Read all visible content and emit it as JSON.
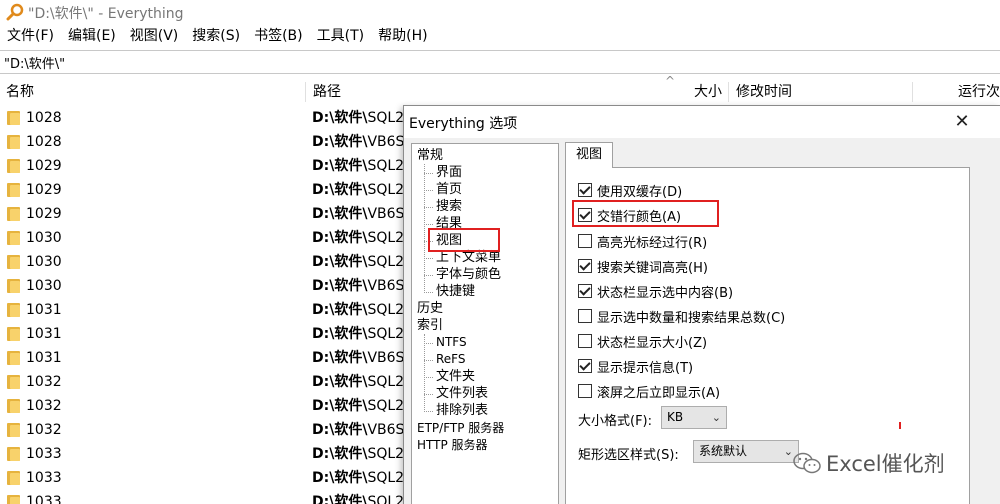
{
  "window": {
    "title": "\"D:\\软件\\\" - Everything",
    "menus": [
      "文件(F)",
      "编辑(E)",
      "视图(V)",
      "搜索(S)",
      "书签(B)",
      "工具(T)",
      "帮助(H)"
    ],
    "search_value": "\"D:\\软件\\\""
  },
  "columns": {
    "name": "名称",
    "path": "路径",
    "size": "大小",
    "modified": "修改时间",
    "run_count": "运行次"
  },
  "rows": [
    {
      "name": "1028",
      "path_bold": "D:\\软件\\",
      "path_rest": "SQL2"
    },
    {
      "name": "1028",
      "path_bold": "D:\\软件\\",
      "path_rest": "VB6S"
    },
    {
      "name": "1029",
      "path_bold": "D:\\软件\\",
      "path_rest": "SQL2"
    },
    {
      "name": "1029",
      "path_bold": "D:\\软件\\",
      "path_rest": "SQL2"
    },
    {
      "name": "1029",
      "path_bold": "D:\\软件\\",
      "path_rest": "VB6S"
    },
    {
      "name": "1030",
      "path_bold": "D:\\软件\\",
      "path_rest": "SQL2"
    },
    {
      "name": "1030",
      "path_bold": "D:\\软件\\",
      "path_rest": "SQL2"
    },
    {
      "name": "1030",
      "path_bold": "D:\\软件\\",
      "path_rest": "VB6S"
    },
    {
      "name": "1031",
      "path_bold": "D:\\软件\\",
      "path_rest": "SQL2"
    },
    {
      "name": "1031",
      "path_bold": "D:\\软件\\",
      "path_rest": "SQL2"
    },
    {
      "name": "1031",
      "path_bold": "D:\\软件\\",
      "path_rest": "VB6S"
    },
    {
      "name": "1032",
      "path_bold": "D:\\软件\\",
      "path_rest": "SQL2"
    },
    {
      "name": "1032",
      "path_bold": "D:\\软件\\",
      "path_rest": "SQL2"
    },
    {
      "name": "1032",
      "path_bold": "D:\\软件\\",
      "path_rest": "VB6S"
    },
    {
      "name": "1033",
      "path_bold": "D:\\软件\\",
      "path_rest": "SQL2"
    },
    {
      "name": "1033",
      "path_bold": "D:\\软件\\",
      "path_rest": "SQL2"
    },
    {
      "name": "1033",
      "path_bold": "D:\\软件\\",
      "path_rest": "SQL2"
    }
  ],
  "dialog": {
    "title": "Everything 选项",
    "close_glyph": "✕",
    "tree": {
      "general": "常规",
      "general_children": [
        "界面",
        "首页",
        "搜索",
        "结果",
        "视图",
        "上下文菜单",
        "字体与颜色",
        "快捷键"
      ],
      "history": "历史",
      "index": "索引",
      "index_children": [
        "NTFS",
        "ReFS",
        "文件夹",
        "文件列表",
        "排除列表"
      ],
      "etp": "ETP/FTP 服务器",
      "http": "HTTP 服务器"
    },
    "tab_label": "视图",
    "options": [
      {
        "label": "使用双缓存(D)",
        "checked": true
      },
      {
        "label": "交错行颜色(A)",
        "checked": true
      },
      {
        "label": "高亮光标经过行(R)",
        "checked": false
      },
      {
        "label": "搜索关键词高亮(H)",
        "checked": true
      },
      {
        "label": "状态栏显示选中内容(B)",
        "checked": true
      },
      {
        "label": "显示选中数量和搜索结果总数(C)",
        "checked": false
      },
      {
        "label": "状态栏显示大小(Z)",
        "checked": false
      },
      {
        "label": "显示提示信息(T)",
        "checked": true
      },
      {
        "label": "滚屏之后立即显示(A)",
        "checked": false
      }
    ],
    "size_format_label": "大小格式(F):",
    "size_format_value": "KB",
    "rect_select_label": "矩形选区样式(S):",
    "rect_select_value": "系统默认"
  },
  "watermark": {
    "text": "Excel催化剂"
  },
  "colors": {
    "highlight": "#e02020",
    "folder": "#f0c24f"
  }
}
